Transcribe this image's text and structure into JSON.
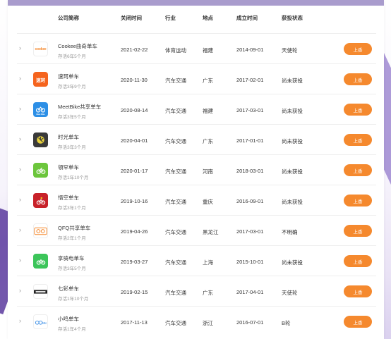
{
  "header": {
    "company": "公司简称",
    "closed": "关闭时间",
    "industry": "行业",
    "location": "地点",
    "founded": "成立时间",
    "funding": "获投状态"
  },
  "action_label": "上香",
  "rows": [
    {
      "name": "Cookee曲奇单车",
      "sub": "存活6年5个月",
      "closed": "2021-02-22",
      "industry": "体育运动",
      "location": "福建",
      "founded": "2014-09-01",
      "status": "天使轮",
      "logo_text": "cookee",
      "logo_color": "#f5892e",
      "logo_bg": "#ffffff",
      "logo_icon": "cookee-logo-icon"
    },
    {
      "name": "速珂单车",
      "sub": "存活3年9个月",
      "closed": "2020-11-30",
      "industry": "汽车交通",
      "location": "广东",
      "founded": "2017-02-01",
      "status": "尚未获投",
      "logo_text": "速珂",
      "logo_color": "#ffffff",
      "logo_bg": "#f5641e",
      "logo_icon": "suke-logo-icon"
    },
    {
      "name": "MeetBike共享单车",
      "sub": "存活3年5个月",
      "closed": "2020-08-14",
      "industry": "汽车交通",
      "location": "福建",
      "founded": "2017-03-01",
      "status": "尚未获投",
      "logo_text": "Meet Bike",
      "logo_color": "#ffffff",
      "logo_bg": "#2d8fe6",
      "logo_icon": "meetbike-logo-icon"
    },
    {
      "name": "时光单车",
      "sub": "存活3年3个月",
      "closed": "2020-04-01",
      "industry": "汽车交通",
      "location": "广东",
      "founded": "2017-01-01",
      "status": "尚未获投",
      "logo_text": "",
      "logo_color": "#e8d23c",
      "logo_bg": "#3a3a3a",
      "logo_icon": "shiguang-logo-icon"
    },
    {
      "name": "領罕单车",
      "sub": "存活1年10个月",
      "closed": "2020-01-17",
      "industry": "汽车交通",
      "location": "河南",
      "founded": "2018-03-01",
      "status": "尚未获投",
      "logo_text": "",
      "logo_color": "#ffffff",
      "logo_bg": "#6cc63c",
      "logo_icon": "linghan-logo-icon"
    },
    {
      "name": "悟空单车",
      "sub": "存活3年1个月",
      "closed": "2019-10-16",
      "industry": "汽车交通",
      "location": "重庆",
      "founded": "2016-09-01",
      "status": "尚未获投",
      "logo_text": "",
      "logo_color": "#ffffff",
      "logo_bg": "#c8222a",
      "logo_icon": "wukong-logo-icon"
    },
    {
      "name": "QFQ共享单车",
      "sub": "存活2年1个月",
      "closed": "2019-04-26",
      "industry": "汽车交通",
      "location": "黑龙江",
      "founded": "2017-03-01",
      "status": "不明确",
      "logo_text": "",
      "logo_color": "#f5892e",
      "logo_bg": "#ffffff",
      "logo_icon": "qfq-logo-icon"
    },
    {
      "name": "享骑电单车",
      "sub": "存活3年5个月",
      "closed": "2019-03-27",
      "industry": "汽车交通",
      "location": "上海",
      "founded": "2015-10-01",
      "status": "尚未获投",
      "logo_text": "",
      "logo_color": "#ffffff",
      "logo_bg": "#3cc55a",
      "logo_icon": "xiangqi-logo-icon"
    },
    {
      "name": "七彩单车",
      "sub": "存活1年10个月",
      "closed": "2019-02-15",
      "industry": "汽车交通",
      "location": "广东",
      "founded": "2017-04-01",
      "status": "天使轮",
      "logo_text": "",
      "logo_color": "#222222",
      "logo_bg": "#ffffff",
      "logo_icon": "qicai-logo-icon"
    },
    {
      "name": "小鸣单车",
      "sub": "存活1年4个月",
      "closed": "2017-11-13",
      "industry": "汽车交通",
      "location": "浙江",
      "founded": "2016-07-01",
      "status": "B轮",
      "logo_text": "",
      "logo_color": "#3a8ee6",
      "logo_bg": "#ffffff",
      "logo_icon": "xiaoming-logo-icon"
    }
  ]
}
